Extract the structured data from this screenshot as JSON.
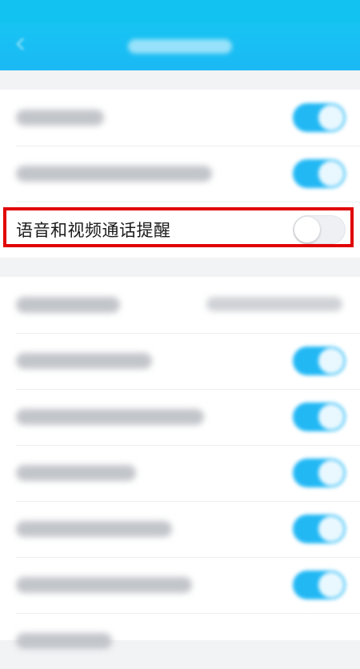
{
  "settings": {
    "voice_video_call_reminder": {
      "label": "语音和视频通话提醒",
      "enabled": false
    }
  },
  "colors": {
    "header": "#1bb9f5",
    "toggle_on": "#22b8f4",
    "highlight_box": "#e00000"
  },
  "icons": {
    "back": "back-arrow-icon",
    "watermark": "baidu-paw-watermark"
  }
}
